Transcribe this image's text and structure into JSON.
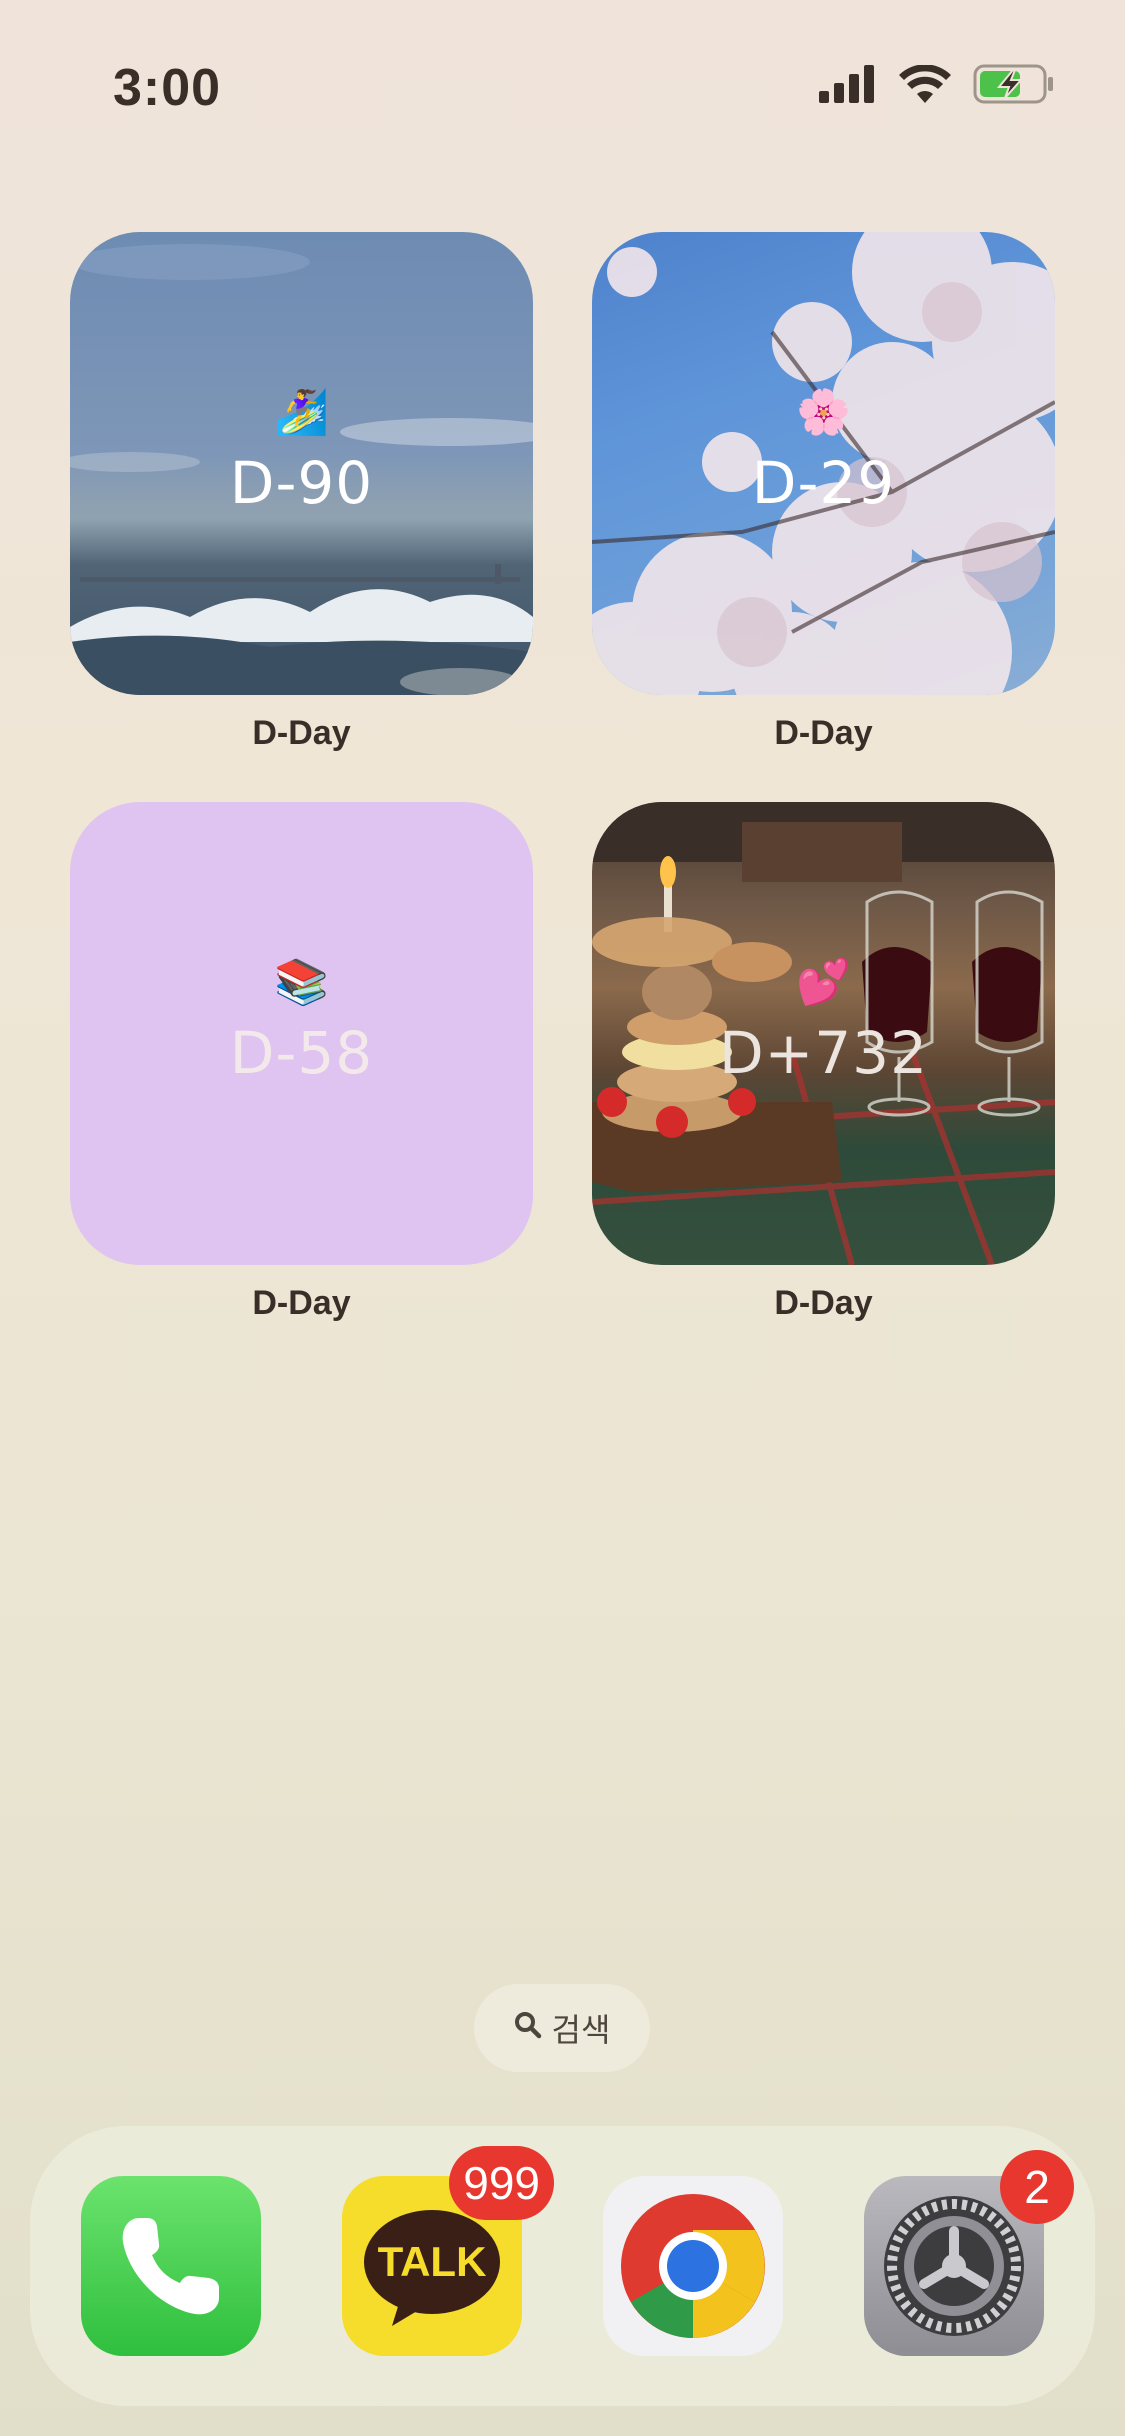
{
  "status_bar": {
    "time": "3:00",
    "icons": [
      "cellular-signal-icon",
      "wifi-icon",
      "battery-charging-icon"
    ]
  },
  "widgets": [
    {
      "emoji": "🏄‍♀️",
      "count": "D-90",
      "label": "D-Day"
    },
    {
      "emoji": "🌸",
      "count": "D-29",
      "label": "D-Day"
    },
    {
      "emoji": "📚",
      "count": "D-58",
      "label": "D-Day"
    },
    {
      "emoji": "💕",
      "count": "D+732",
      "label": "D-Day"
    }
  ],
  "search": {
    "label": "검색"
  },
  "dock": {
    "apps": [
      {
        "name": "Phone",
        "icon": "phone-icon"
      },
      {
        "name": "KakaoTalk",
        "icon": "kakaotalk-icon",
        "icon_text": "TALK",
        "badge": "999"
      },
      {
        "name": "Chrome",
        "icon": "chrome-icon"
      },
      {
        "name": "Settings",
        "icon": "settings-gear-icon",
        "badge": "2"
      }
    ]
  }
}
